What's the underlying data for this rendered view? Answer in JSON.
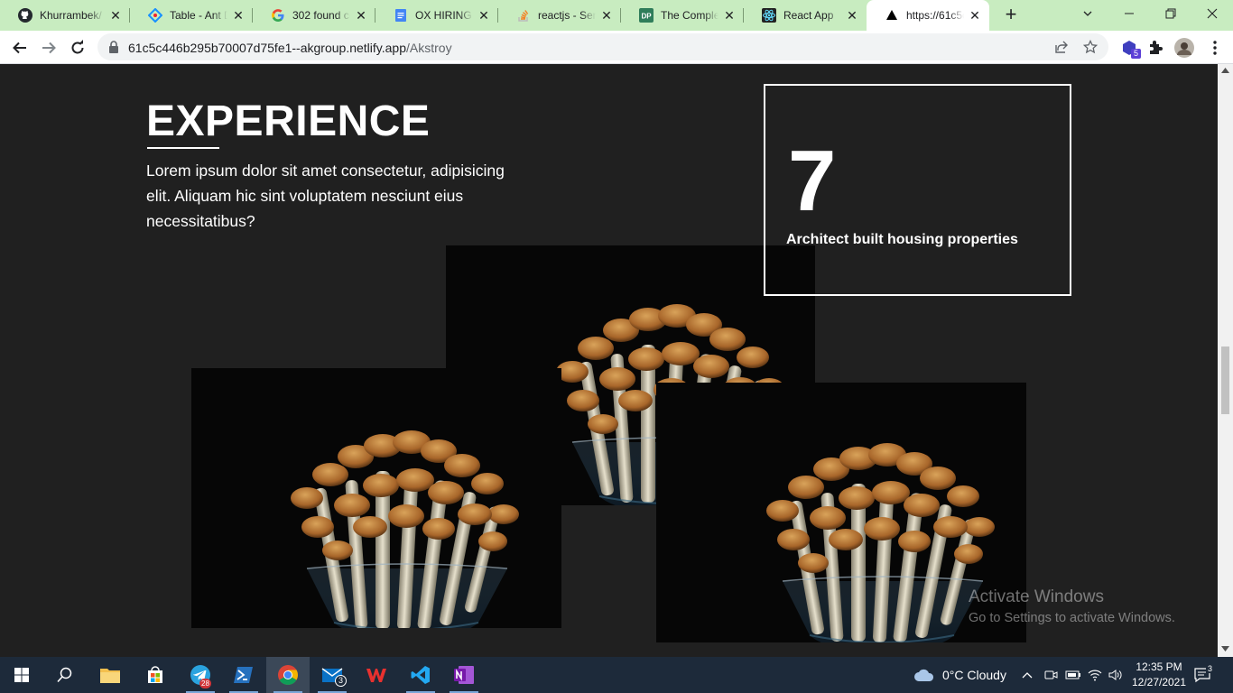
{
  "browser": {
    "tabs": [
      {
        "title": "Khurrambek/",
        "icon": "github-icon"
      },
      {
        "title": "Table - Ant D",
        "icon": "ant-design-icon"
      },
      {
        "title": "302 found co",
        "icon": "google-icon"
      },
      {
        "title": "OX HIRING | F",
        "icon": "google-docs-icon"
      },
      {
        "title": "reactjs - Send",
        "icon": "stackoverflow-icon"
      },
      {
        "title": "The Complete",
        "icon": "dp-icon"
      },
      {
        "title": "React App",
        "icon": "react-icon"
      },
      {
        "title": "https://61c5c",
        "icon": "netlify-icon",
        "active": true
      }
    ],
    "url_host": "61c5c446b295b70007d75fe1--akgroup.netlify.app",
    "url_path": "/Akstroy",
    "extension_badge": "5"
  },
  "page": {
    "heading": "EXPERIENCE",
    "description": "Lorem ipsum dolor sit amet consectetur, adipisicing elit. Aliquam hic sint voluptatem nesciunt eius necessitatibus?",
    "stat_number": "7",
    "stat_label": "Architect built housing properties",
    "images": [
      "mushroom-photo",
      "mushroom-photo",
      "mushroom-photo"
    ]
  },
  "watermark": {
    "line1": "Activate Windows",
    "line2": "Go to Settings to activate Windows."
  },
  "taskbar": {
    "apps": [
      "file-explorer",
      "microsoft-store",
      "telegram",
      "powershell",
      "chrome",
      "mail",
      "wps-office",
      "vscode",
      "onenote"
    ],
    "telegram_badge": "28",
    "mail_badge": "3",
    "weather": "0°C  Cloudy",
    "time": "12:35 PM",
    "date": "12/27/2021",
    "notification_count": "3"
  }
}
